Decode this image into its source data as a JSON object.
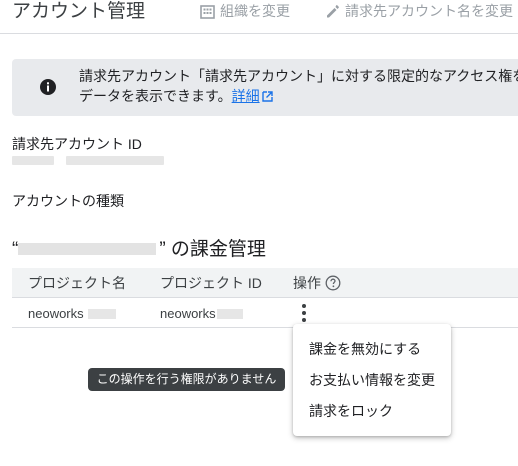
{
  "header": {
    "title": "アカウント管理",
    "change_org_label": "組織を変更",
    "rename_label": "請求先アカウント名を変更"
  },
  "banner": {
    "line1": "請求先アカウント「請求先アカウント」に対する限定的なアクセス権を",
    "line2": "データを表示できます。",
    "link": "詳細"
  },
  "account": {
    "id_label": "請求先アカウント ID",
    "type_label": "アカウントの種類"
  },
  "section": {
    "title_open": "“",
    "title_close": "” の課金管理"
  },
  "table": {
    "columns": [
      "プロジェクト名",
      "プロジェクト ID",
      "操作"
    ],
    "rows": [
      {
        "name": "neoworks",
        "id": "neoworks"
      }
    ]
  },
  "menu": {
    "items": [
      "課金を無効にする",
      "お支払い情報を変更",
      "請求をロック"
    ]
  },
  "tooltip": "この操作を行う権限がありません",
  "icons": [
    "org-icon",
    "edit-icon",
    "info-icon",
    "external-link-icon",
    "help-icon",
    "more-vert-icon"
  ]
}
